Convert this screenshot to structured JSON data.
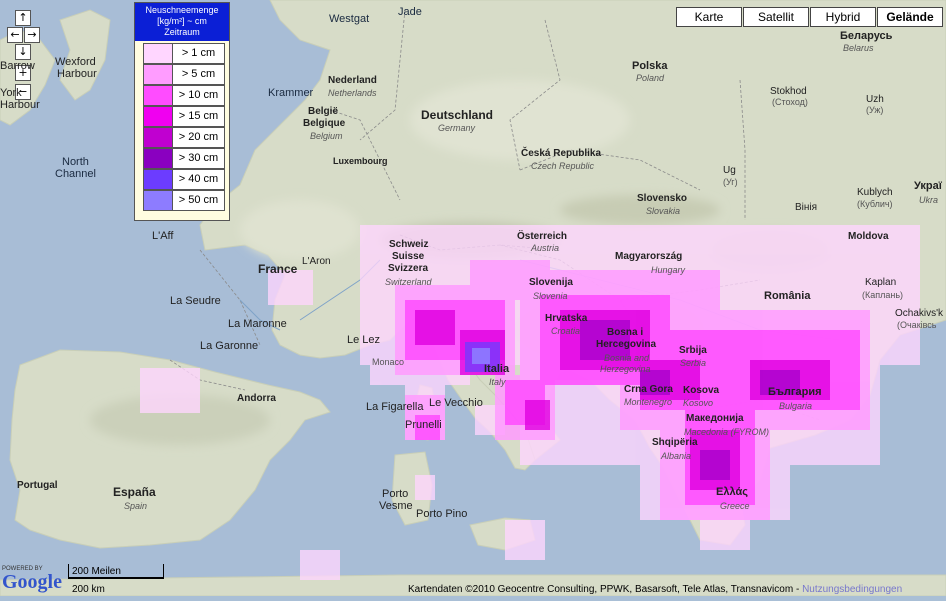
{
  "controls": {
    "pan_up": "↑",
    "pan_left": "←",
    "pan_right": "→",
    "pan_down": "↓",
    "zoom_in": "+",
    "zoom_out": "−"
  },
  "map_types": [
    {
      "label": "Karte",
      "active": false
    },
    {
      "label": "Satellit",
      "active": false
    },
    {
      "label": "Hybrid",
      "active": false
    },
    {
      "label": "Gelände",
      "active": true
    }
  ],
  "legend": {
    "title_line1": "Neuschneemenge",
    "title_line2": "[kg/m²] ~ cm",
    "title_line3": "Zeitraum",
    "items": [
      {
        "label": "> 1 cm",
        "color": "#ffd6ff"
      },
      {
        "label": "> 5 cm",
        "color": "#ff9cff"
      },
      {
        "label": "> 10 cm",
        "color": "#ff4cff"
      },
      {
        "label": "> 15 cm",
        "color": "#f000f0"
      },
      {
        "label": "> 20 cm",
        "color": "#c000d0"
      },
      {
        "label": "> 30 cm",
        "color": "#8a00c0"
      },
      {
        "label": "> 40 cm",
        "color": "#6c3cff"
      },
      {
        "label": "> 50 cm",
        "color": "#8d7cff"
      }
    ]
  },
  "labels": {
    "barrow": "Barrow",
    "wexford": "Wexford",
    "harbour": "Harbour",
    "york": "York",
    "harbour2": "Harbour",
    "north_channel1": "North",
    "north_channel2": "Channel",
    "westgat": "Westgat",
    "jade": "Jade",
    "nederland": "Nederland",
    "netherlands": "Netherlands",
    "krammer": "Krammer",
    "belgie": "België",
    "belgique": "Belgique",
    "belgium": "Belgium",
    "luxembourg": "Luxembourg",
    "deutschland": "Deutschland",
    "germany": "Germany",
    "polska": "Polska",
    "poland": "Poland",
    "belarus_cyr": "Беларусь",
    "belarus": "Belarus",
    "stokhod": "Stokhod",
    "stokhod_cyr": "(Стоход)",
    "uzh": "Uzh",
    "uzh_cyr": "(Уж)",
    "ceska": "Česká Republika",
    "czech": "Czech Republic",
    "ug": "Ug",
    "ug_cyr": "(Уг)",
    "slovensko": "Slovensko",
    "slovakia": "Slovakia",
    "kublych": "Kublych",
    "kublych_cyr": "(Кублич)",
    "vinia": "Вінія",
    "ukraina": "Украї",
    "ukraine": "Ukra",
    "osterreich": "Österreich",
    "austria": "Austria",
    "laff": "L'Aff",
    "france": "France",
    "laron": "L'Aron",
    "schweiz": "Schweiz",
    "suisse": "Suisse",
    "svizzera": "Svizzera",
    "switzerland": "Switzerland",
    "magyar": "Magyarország",
    "hungary": "Hungary",
    "moldova": "Moldova",
    "kaplan": "Kaplan",
    "kaplan_cyr": "(Каплань)",
    "lasaudre": "La Seudre",
    "lamaronne": "La Maronne",
    "lagaronne": "La Garonne",
    "slovenija": "Slovenija",
    "slovenia": "Slovenia",
    "romania": "România",
    "ochakivs": "Ochakivs'k",
    "ochakivs_cyr": "(Очаківсь",
    "hrvatska": "Hrvatska",
    "croatia": "Croatia",
    "bosna1": "Bosna i",
    "hercegovina": "Hercegovina",
    "bosnia1": "Bosnia and",
    "herzegovina": "Herzegovina",
    "lelez": "Le Lez",
    "monaco": "Monaco",
    "srbija": "Srbija",
    "serbia": "Serbia",
    "italia": "Italia",
    "italy": "Italy",
    "crna_gora": "Crna Gora",
    "montenegro": "Montenegro",
    "kosova": "Kosova",
    "kosovo": "Kosovo",
    "andorra": "Andorra",
    "bulgaria_cyr": "България",
    "bulgaria": "Bulgaria",
    "lafigarella": "La Figarella",
    "levecchio": "Le Vecchio",
    "prunelli": "Prunelli",
    "makedonija": "Македонија",
    "macedonia": "Macedonia (FYROM)",
    "shqiperia": "Shqipëria",
    "albania": "Albania",
    "portugal": "Portugal",
    "espana": "España",
    "spain": "Spain",
    "porto1": "Porto",
    "vesme": "Vesme",
    "portopino": "Porto Pino",
    "ellas": "Ελλάς",
    "greece": "Greece"
  },
  "scale": {
    "top": "200 Meilen",
    "bottom": "200 km"
  },
  "google": {
    "powered": "POWERED BY",
    "logo": "Google"
  },
  "copyright": {
    "text": "Kartendaten ©2010 Geocentre Consulting, PPWK, Basarsoft, Tele Atlas, Transnavicom -",
    "link": "Nutzungsbedingungen"
  }
}
